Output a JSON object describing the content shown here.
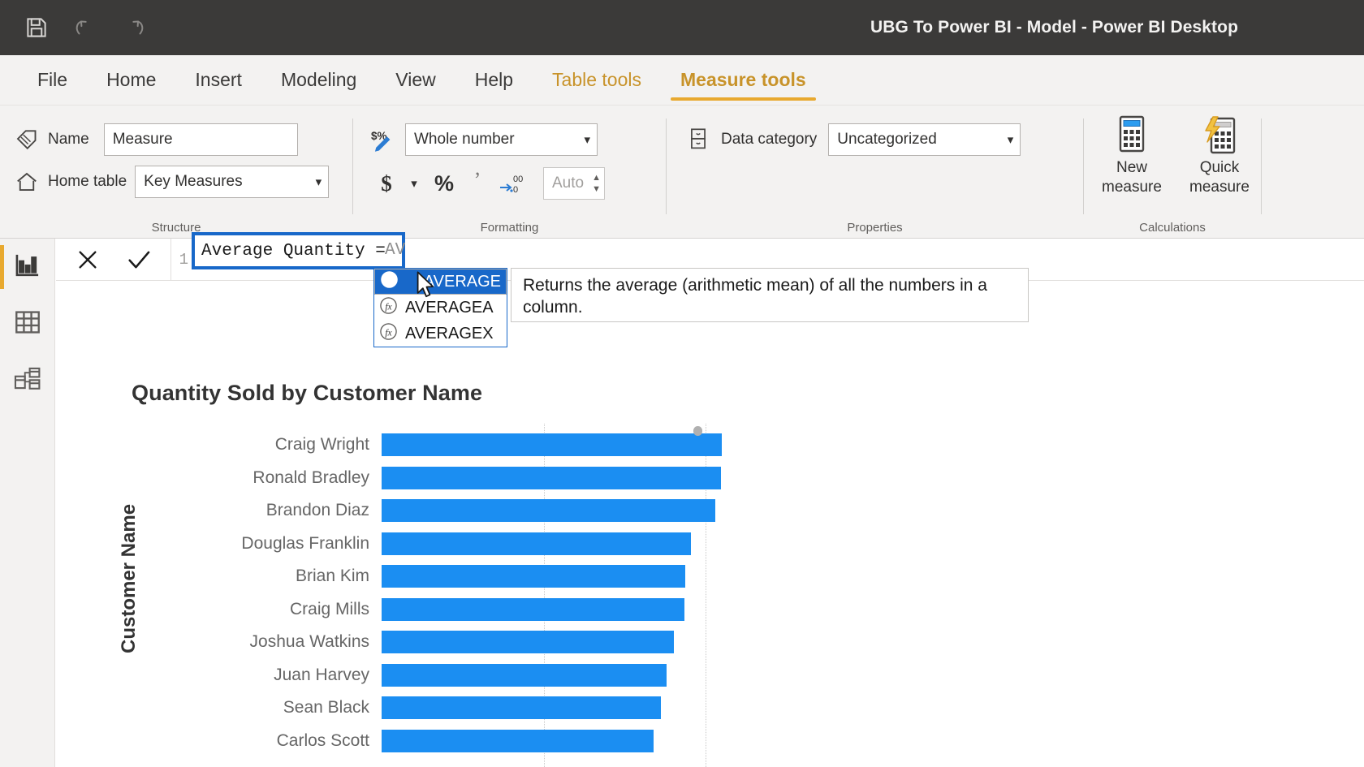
{
  "window": {
    "title": "UBG To Power BI - Model - Power BI Desktop",
    "quick_access": [
      {
        "name": "save-icon",
        "label": "Save"
      },
      {
        "name": "undo-icon",
        "label": "Undo"
      },
      {
        "name": "redo-icon",
        "label": "Redo"
      }
    ]
  },
  "ribbon": {
    "tabs": [
      {
        "label": "File",
        "state": "normal"
      },
      {
        "label": "Home",
        "state": "normal"
      },
      {
        "label": "Insert",
        "state": "normal"
      },
      {
        "label": "Modeling",
        "state": "normal"
      },
      {
        "label": "View",
        "state": "normal"
      },
      {
        "label": "Help",
        "state": "normal"
      },
      {
        "label": "Table tools",
        "state": "contextual"
      },
      {
        "label": "Measure tools",
        "state": "active"
      }
    ],
    "groups": {
      "structure": {
        "label": "Structure",
        "name_label": "Name",
        "name_value": "Measure",
        "home_table_label": "Home table",
        "home_table_value": "Key Measures"
      },
      "formatting": {
        "label": "Formatting",
        "format_value": "Whole number",
        "currency_label": "$",
        "percent_label": "%",
        "thousands_label": ",",
        "decimals_value": "Auto",
        "decimals_placeholder": "Auto"
      },
      "properties": {
        "label": "Properties",
        "data_category_label": "Data category",
        "data_category_value": "Uncategorized"
      },
      "calculations": {
        "label": "Calculations",
        "new_measure_line1": "New",
        "new_measure_line2": "measure",
        "quick_measure_line1": "Quick",
        "quick_measure_line2": "measure"
      }
    }
  },
  "view_bar": {
    "items": [
      {
        "name": "report-view",
        "icon": "bar-chart-icon",
        "active": true
      },
      {
        "name": "data-view",
        "icon": "table-icon",
        "active": false
      },
      {
        "name": "model-view",
        "icon": "model-relationships-icon",
        "active": false
      }
    ]
  },
  "formula_bar": {
    "cancel_label": "✕",
    "commit_label": "✓",
    "line_number": "1",
    "committed_text": "Average Quantity = ",
    "typed_text": "AV"
  },
  "autocomplete": {
    "items": [
      {
        "label": "AVERAGE",
        "selected": true
      },
      {
        "label": "AVERAGEA",
        "selected": false
      },
      {
        "label": "AVERAGEX",
        "selected": false
      }
    ],
    "tooltip": "Returns the average (arithmetic mean) of all the numbers in a column."
  },
  "chart_data": {
    "type": "bar",
    "title": "Quantity Sold by Customer Name",
    "xlabel": "",
    "ylabel": "Customer Name",
    "orientation": "horizontal",
    "grid": true,
    "legend": "none",
    "bar_color": "#1b8ef2",
    "categories": [
      "Craig Wright",
      "Ronald Bradley",
      "Brandon Diaz",
      "Douglas Franklin",
      "Brian Kim",
      "Craig Mills",
      "Joshua Watkins",
      "Juan Harvey",
      "Sean Black",
      "Carlos Scott"
    ],
    "values": [
      420,
      419,
      412,
      382,
      375,
      374,
      361,
      352,
      345,
      336
    ],
    "xlim": [
      0,
      470
    ],
    "gridline_values": [
      200,
      400
    ],
    "truncated": true
  }
}
